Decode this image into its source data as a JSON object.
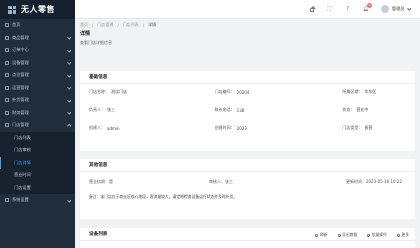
{
  "app": {
    "title": "无人零售"
  },
  "sidebar": {
    "items": [
      {
        "label": "首页"
      },
      {
        "label": "商品管理"
      },
      {
        "label": "订单中心"
      },
      {
        "label": "设备管理"
      },
      {
        "label": "点位管理"
      },
      {
        "label": "运营管理"
      },
      {
        "label": "补货管理"
      },
      {
        "label": "财务管理"
      },
      {
        "label": "门店管理"
      }
    ],
    "subitems": [
      {
        "label": "门店列表"
      },
      {
        "label": "门店审核"
      },
      {
        "label": "门店详情"
      },
      {
        "label": "营业时间"
      },
      {
        "label": "门店设置"
      }
    ],
    "tail_items": [
      {
        "label": "系统设置"
      }
    ]
  },
  "header": {
    "badge_count": "9",
    "username": "管理员"
  },
  "breadcrumb": {
    "items": [
      "首页",
      "门店管理",
      "门店列表"
    ],
    "current": "详情"
  },
  "page": {
    "title": "详情",
    "description": "查看门店详细信息"
  },
  "basic_info": {
    "title": "基础信息",
    "fields": [
      {
        "label": "门店名称：",
        "value": "测试门店"
      },
      {
        "label": "门店编号：",
        "value": "20204"
      },
      {
        "label": "所属区域：",
        "value": "华东区"
      },
      {
        "label": "负责人：",
        "value": "张三"
      },
      {
        "label": "联系电话：",
        "value": "138"
      },
      {
        "label": "状态：",
        "value": "营业中"
      },
      {
        "label": "创建人：",
        "value": "admin"
      },
      {
        "label": "创建时间：",
        "value": "2023"
      },
      {
        "label": "门店类型：",
        "value": "直营"
      }
    ]
  },
  "other_info": {
    "title": "其他信息",
    "row": {
      "c1": "营业执照：是",
      "c2": "审核人：张三",
      "c3": "更新时间：2023-05-16 10:22"
    },
    "notes_label": "备注：",
    "notes_value": "该门店位于商业区核心地段，客流量较大，请定期检查设备运行状态并及时补货。"
  },
  "device_card": {
    "title": "设备列表",
    "tools": [
      {
        "label": "刷新"
      },
      {
        "label": "导出数据"
      },
      {
        "label": "批量操作"
      },
      {
        "label": "更多"
      }
    ]
  }
}
